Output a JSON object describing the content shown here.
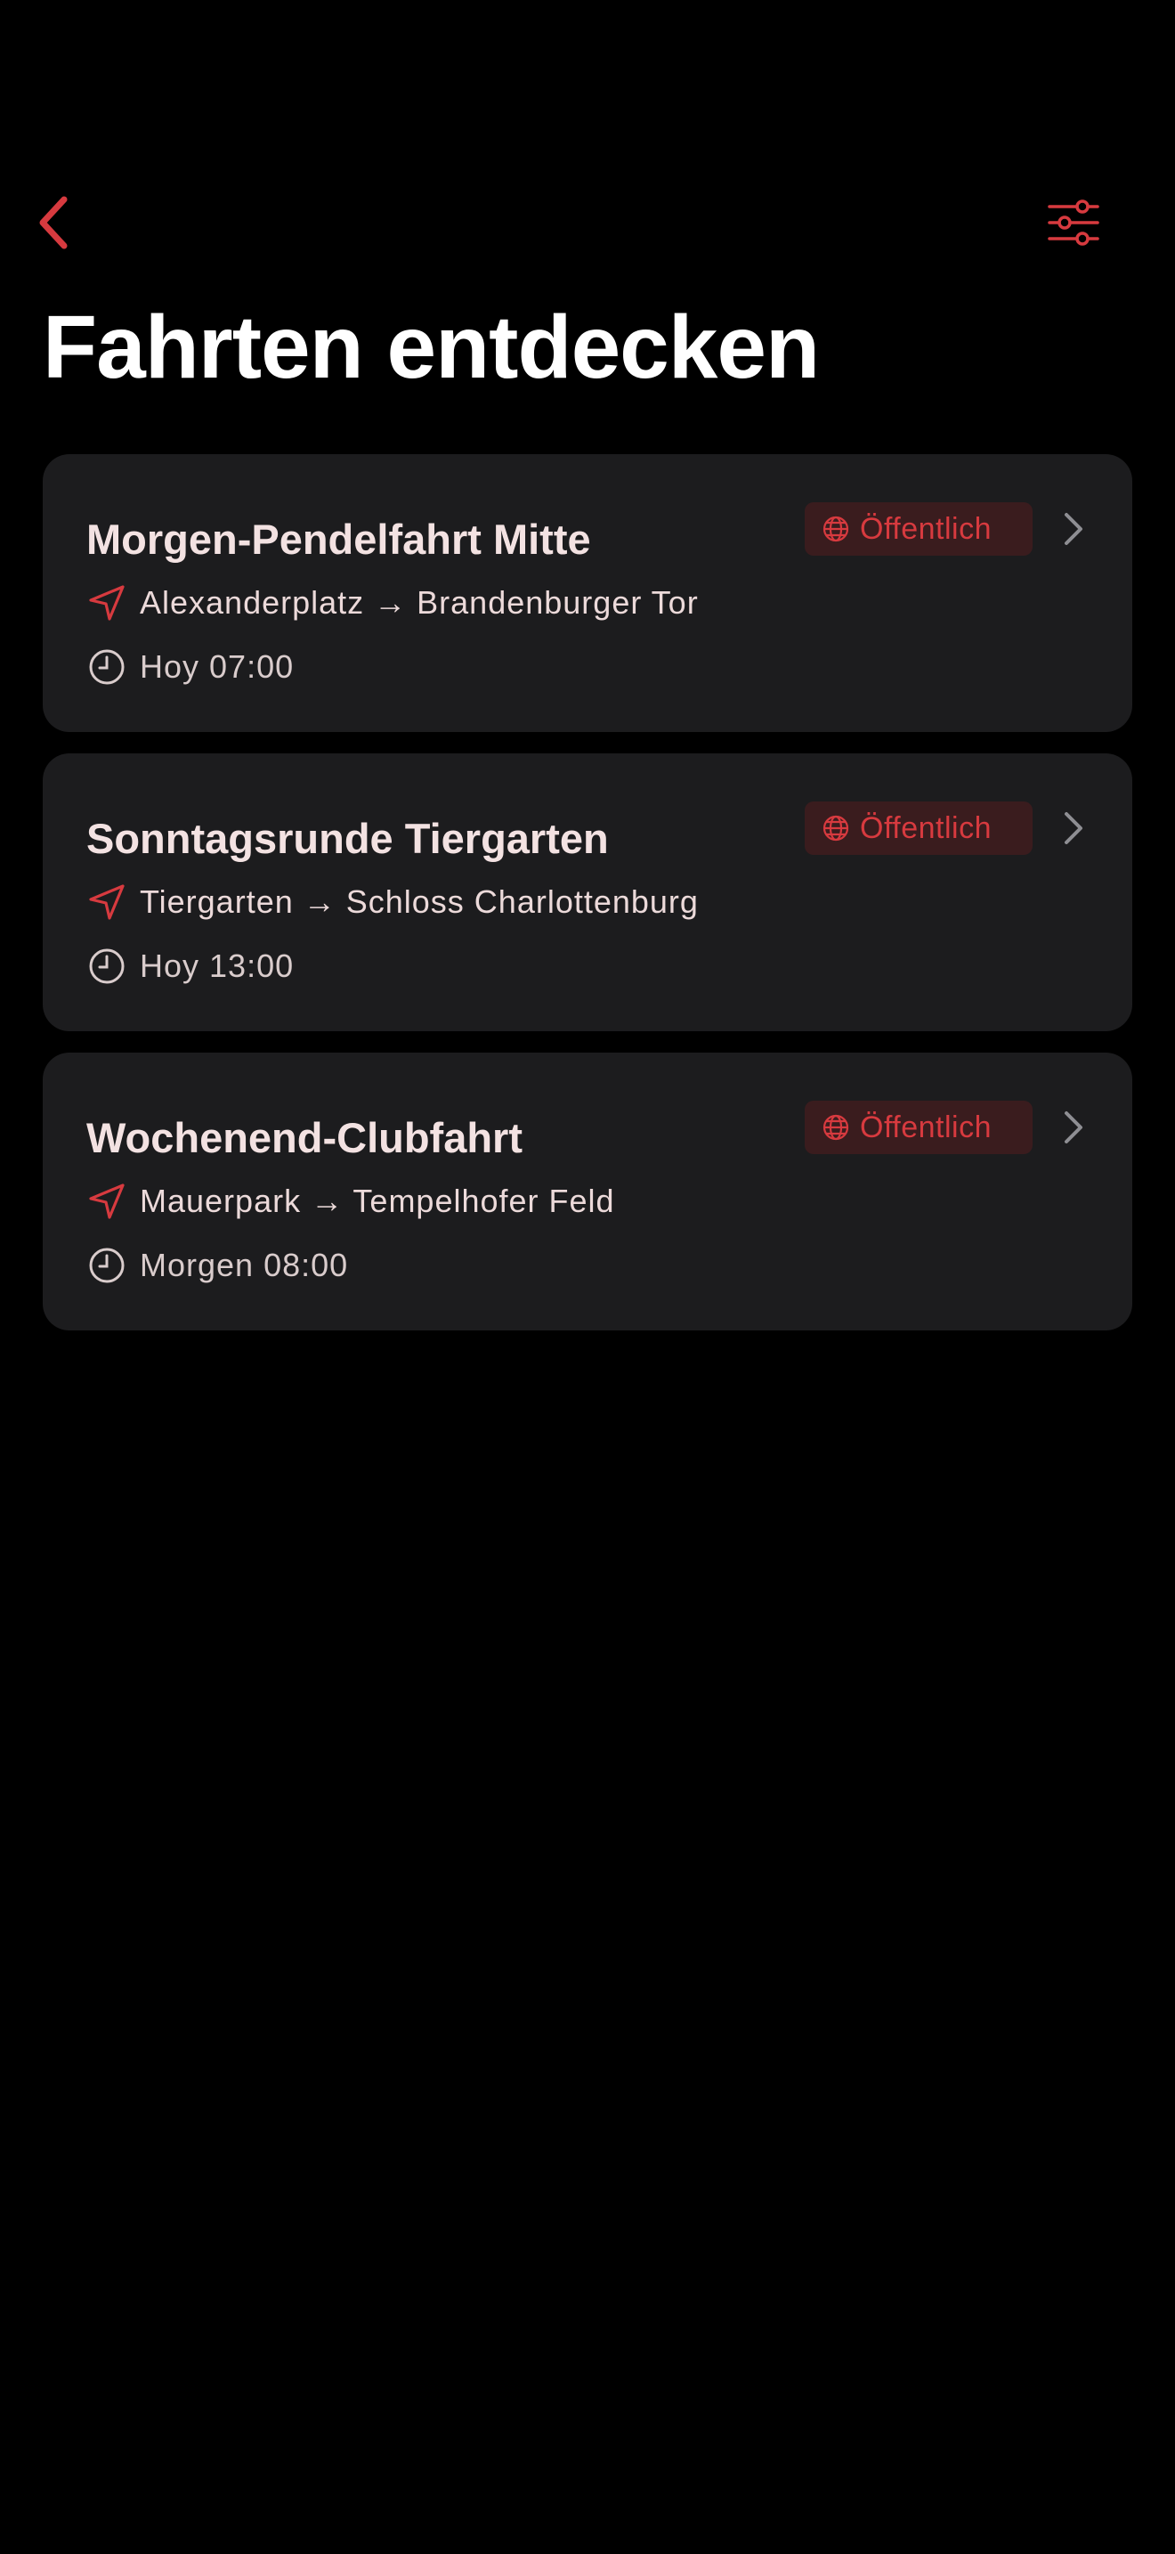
{
  "colors": {
    "accent": "#d73a3f",
    "background": "#000000",
    "card": "#1c1c1e",
    "badge_background": "#3a1c1e",
    "text_primary": "#f3e2e2",
    "chevron": "#8e8e93"
  },
  "nav": {
    "back_icon": "chevron-left-icon",
    "filter_icon": "sliders-icon"
  },
  "page": {
    "title": "Fahrten entdecken"
  },
  "rides": [
    {
      "title": "Morgen-Pendelfahrt Mitte",
      "visibility": "Öffentlich",
      "route": "Alexanderplatz → Brandenburger Tor",
      "time": "Hoy 07:00"
    },
    {
      "title": "Sonntagsrunde Tiergarten",
      "visibility": "Öffentlich",
      "route": "Tiergarten → Schloss Charlottenburg",
      "time": "Hoy 13:00"
    },
    {
      "title": "Wochenend-Clubfahrt",
      "visibility": "Öffentlich",
      "route": "Mauerpark → Tempelhofer Feld",
      "time": "Morgen 08:00"
    }
  ]
}
